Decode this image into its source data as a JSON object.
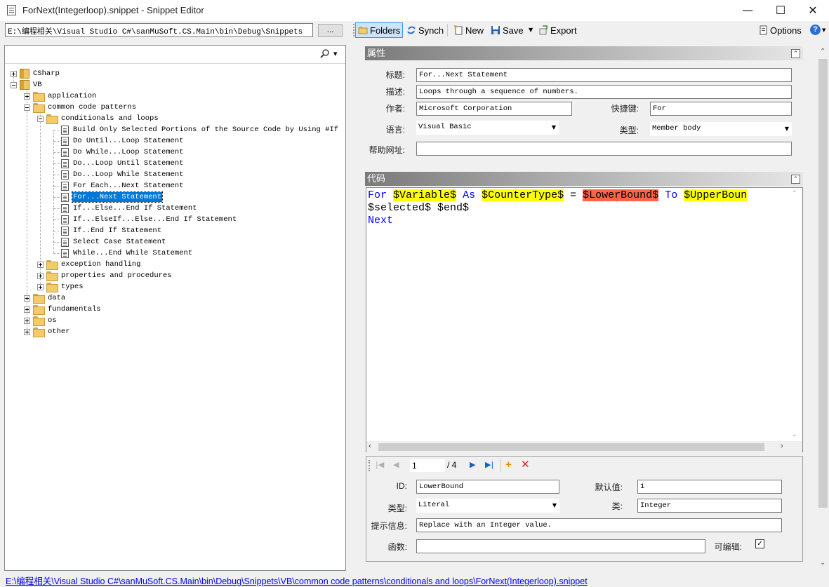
{
  "window": {
    "title": "ForNext(Integerloop).snippet - Snippet Editor",
    "minimize": "—",
    "maximize": "☐",
    "close": "✕"
  },
  "path": {
    "value": "E:\\编程相关\\Visual Studio C#\\sanMuSoft.CS.Main\\bin\\Debug\\Snippets",
    "browse": "..."
  },
  "toolbar": {
    "folders": "Folders",
    "synch": "Synch",
    "new": "New",
    "save": "Save",
    "export": "Export",
    "options": "Options"
  },
  "tree": {
    "items": [
      {
        "label": "CSharp"
      },
      {
        "label": "VB"
      },
      {
        "label": "application"
      },
      {
        "label": "common code patterns"
      },
      {
        "label": "conditionals and loops"
      },
      {
        "label": "Build Only Selected Portions of the Source Code by Using #If"
      },
      {
        "label": "Do Until...Loop Statement"
      },
      {
        "label": "Do While...Loop Statement"
      },
      {
        "label": "Do...Loop Until Statement"
      },
      {
        "label": "Do...Loop While Statement"
      },
      {
        "label": "For Each...Next Statement"
      },
      {
        "label": "For...Next Statement"
      },
      {
        "label": "If...Else...End If Statement"
      },
      {
        "label": "If...ElseIf...Else...End If Statement"
      },
      {
        "label": "If..End If Statement"
      },
      {
        "label": "Select Case Statement"
      },
      {
        "label": "While...End While Statement"
      },
      {
        "label": "exception handling"
      },
      {
        "label": "properties and procedures"
      },
      {
        "label": "types"
      },
      {
        "label": "data"
      },
      {
        "label": "fundamentals"
      },
      {
        "label": "os"
      },
      {
        "label": "other"
      }
    ]
  },
  "properties": {
    "header": "属性",
    "title_label": "标题:",
    "title_value": "For...Next Statement",
    "desc_label": "描述:",
    "desc_value": "Loops through a sequence of numbers.",
    "author_label": "作者:",
    "author_value": "Microsoft Corporation",
    "shortcut_label": "快捷键:",
    "shortcut_value": "For",
    "language_label": "语言:",
    "language_value": "Visual Basic",
    "type_label": "类型:",
    "type_value": "Member body",
    "help_label": "帮助网址:",
    "help_value": ""
  },
  "code": {
    "header": "代码",
    "line1": {
      "t1": "For",
      "t2": "$Variable$",
      "t3": "As",
      "t4": "$CounterType$",
      "t5": "=",
      "t6": "$LowerBound$",
      "t7": "To",
      "t8": "$UpperBoun"
    },
    "line2": "$selected$ $end$",
    "line3": "Next"
  },
  "literal": {
    "position": "1",
    "total": "/ 4",
    "id_label": "ID:",
    "id_value": "LowerBound",
    "default_label": "默认值:",
    "default_value": "1",
    "type_label": "类型:",
    "type_value": "Literal",
    "class_label": "类:",
    "class_value": "Integer",
    "tooltip_label": "提示信息:",
    "tooltip_value": "Replace with an Integer value.",
    "function_label": "函数:",
    "function_value": "",
    "editable_label": "可编辑:",
    "editable_check": "✓"
  },
  "status": {
    "path": "E:\\编程相关\\Visual Studio C#\\sanMuSoft.CS.Main\\bin\\Debug\\Snippets\\VB\\common code patterns\\conditionals and loops\\ForNext(Integerloop).snippet"
  },
  "colors": {
    "selection": "#0078d7",
    "keyword": "#0000ff",
    "placeholder_highlight": "#ffff00",
    "active_placeholder": "#ff6347"
  }
}
